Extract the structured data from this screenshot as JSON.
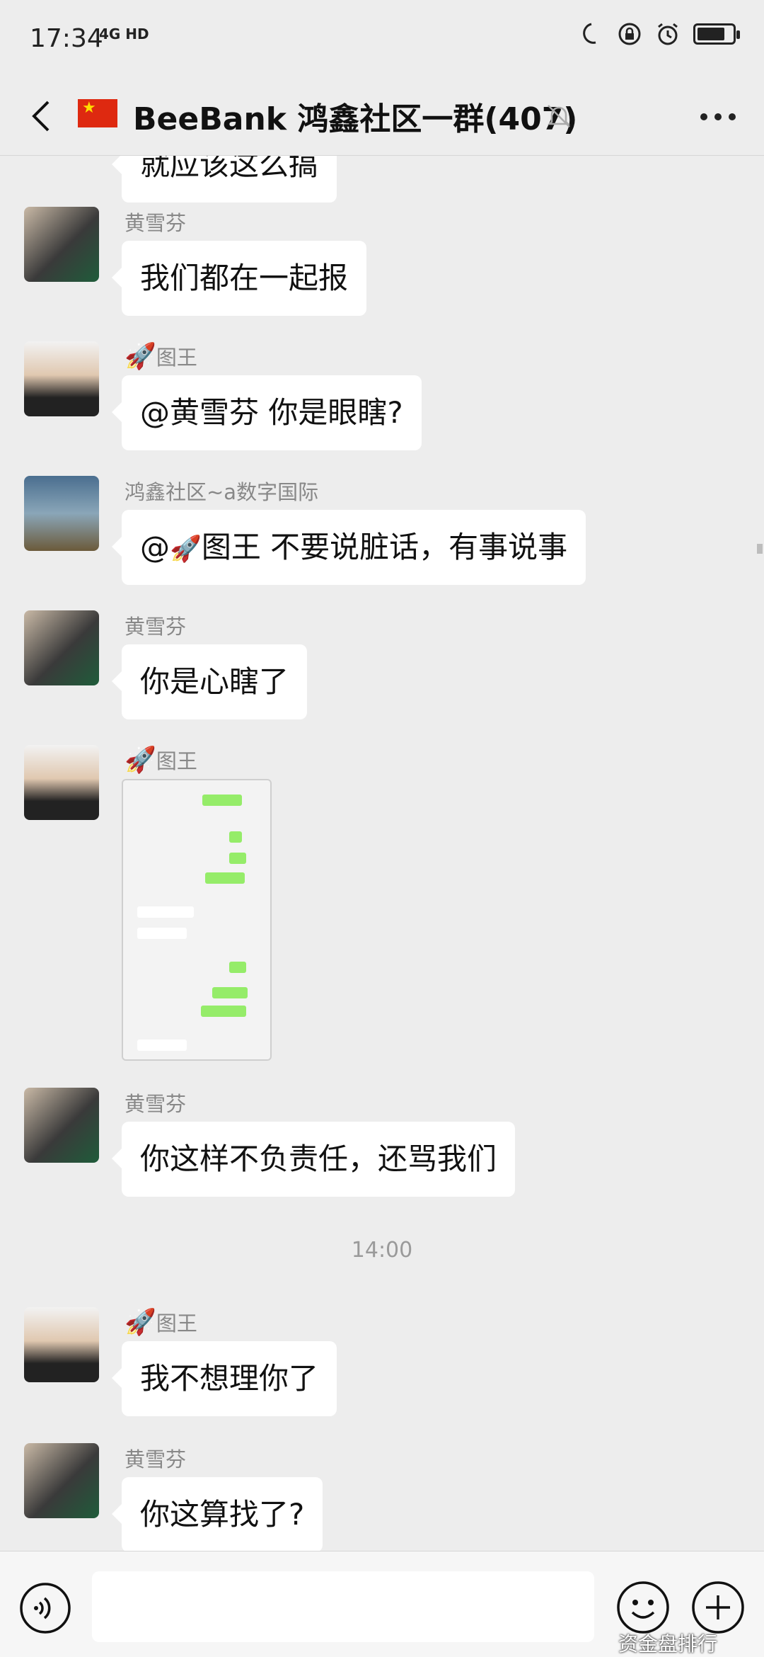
{
  "status_bar": {
    "time": "17:34",
    "network": "4G HD",
    "battery_level": 0.8
  },
  "header": {
    "back_icon": "chevron-left-icon",
    "flag_icon": "china-flag-icon",
    "title": "BeeBank 鸿鑫社区一群(407)",
    "mute_icon": "bell-off-icon",
    "more_icon": "more-dots-icon"
  },
  "messages": [
    {
      "sender": "",
      "text": "就应该这么搞"
    },
    {
      "sender": "黄雪芬",
      "text": "我们都在一起报"
    },
    {
      "sender": "图王",
      "text": "@黄雪芬  你是眼瞎?"
    },
    {
      "sender": "鸿鑫社区~a数字国际",
      "text_prefix": "@",
      "text_suffix": "图王  不要说脏话，有事说事"
    },
    {
      "sender": "黄雪芬",
      "text": "你是心瞎了"
    },
    {
      "sender": "图王",
      "image": "screenshot-image"
    },
    {
      "sender": "黄雪芬",
      "text": "你这样不负责任，还骂我们"
    },
    {
      "sender": "图王",
      "text": "我不想理你了"
    },
    {
      "sender": "黄雪芬",
      "text": "你这算找了?"
    }
  ],
  "time_divider": "14:00",
  "colors": {
    "background": "#ededed",
    "bubble": "#ffffff",
    "sender_name": "#888888",
    "green_bubble": "#95ec69"
  },
  "input_bar": {
    "voice_icon": "voice-icon",
    "emoji_icon": "emoji-icon",
    "plus_icon": "plus-icon",
    "placeholder": ""
  },
  "watermark": "资金盘排行"
}
